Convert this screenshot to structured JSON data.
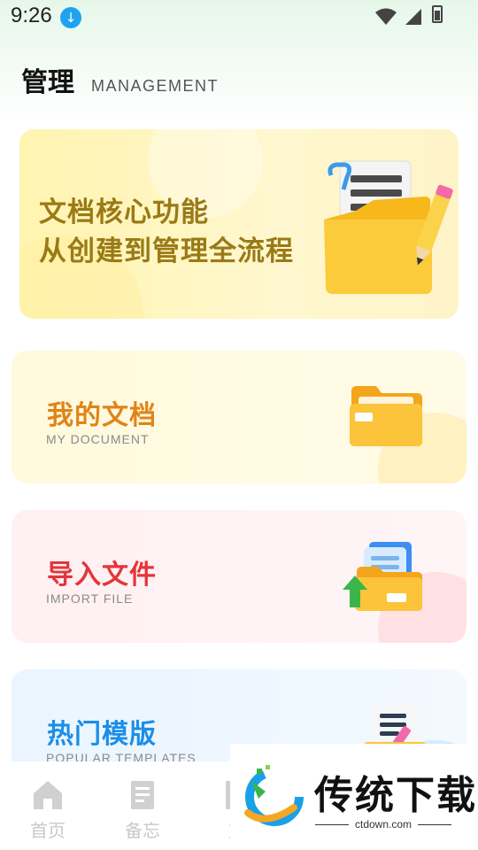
{
  "status_bar": {
    "time": "9:26"
  },
  "header": {
    "title": "管理",
    "subtitle": "MANAGEMENT"
  },
  "banner": {
    "line1": "文档核心功能",
    "line2": "从创建到管理全流程"
  },
  "cards": [
    {
      "title": "我的文档",
      "subtitle": "MY DOCUMENT",
      "title_color": "#e08418"
    },
    {
      "title": "导入文件",
      "subtitle": "IMPORT FILE",
      "title_color": "#e5343a"
    },
    {
      "title": "热门模版",
      "subtitle": "POPULAR TEMPLATES",
      "title_color": "#1b8ee8"
    }
  ],
  "bottom_nav": {
    "items": [
      {
        "label": "首页",
        "icon": "home-icon"
      },
      {
        "label": "备忘",
        "icon": "memo-icon"
      },
      {
        "label": "文",
        "icon": "document-icon"
      }
    ]
  },
  "watermark": {
    "brand": "传统下载",
    "url": "ctdown.com"
  }
}
